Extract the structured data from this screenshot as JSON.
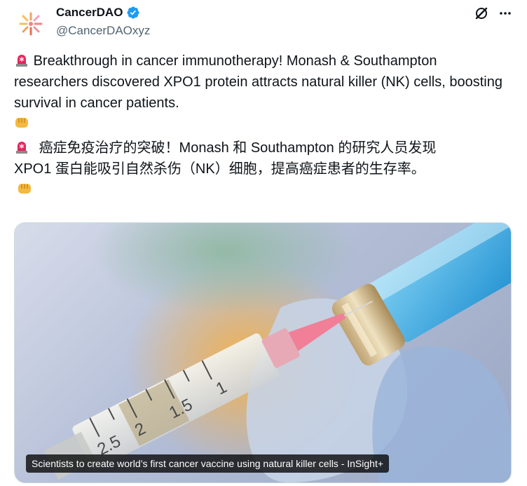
{
  "account": {
    "display_name": "CancerDAO",
    "handle": "@CancerDAOxyz",
    "verified": true
  },
  "icons": {
    "avatar": "cancerdao-logo",
    "verified": "verified-badge-icon",
    "grok": "grok-icon",
    "more": "more-icon",
    "siren": "police-light-emoji",
    "fist": "oncoming-fist-emoji"
  },
  "tweet": {
    "paragraph1_text": "Breakthrough in cancer immunotherapy! Monash & Southampton researchers discovered XPO1 protein attracts natural killer (NK) cells, boosting survival in cancer patients.",
    "paragraph2_line1": "癌症免疫治疗的突破！Monash 和 Southampton 的研究人员发现",
    "paragraph2_line2": "XPO1 蛋白能吸引自然杀伤（NK）细胞，提高癌症患者的生存率。"
  },
  "media": {
    "caption": "Scientists to create world’s first cancer vaccine using natural killer cells - InSight+",
    "syringe_marks": [
      "2.5",
      "2",
      "1.5",
      "1"
    ]
  },
  "colors": {
    "text": "#0f1419",
    "secondary": "#536471",
    "verified": "#1d9bf0",
    "siren_red": "#e0245e"
  }
}
